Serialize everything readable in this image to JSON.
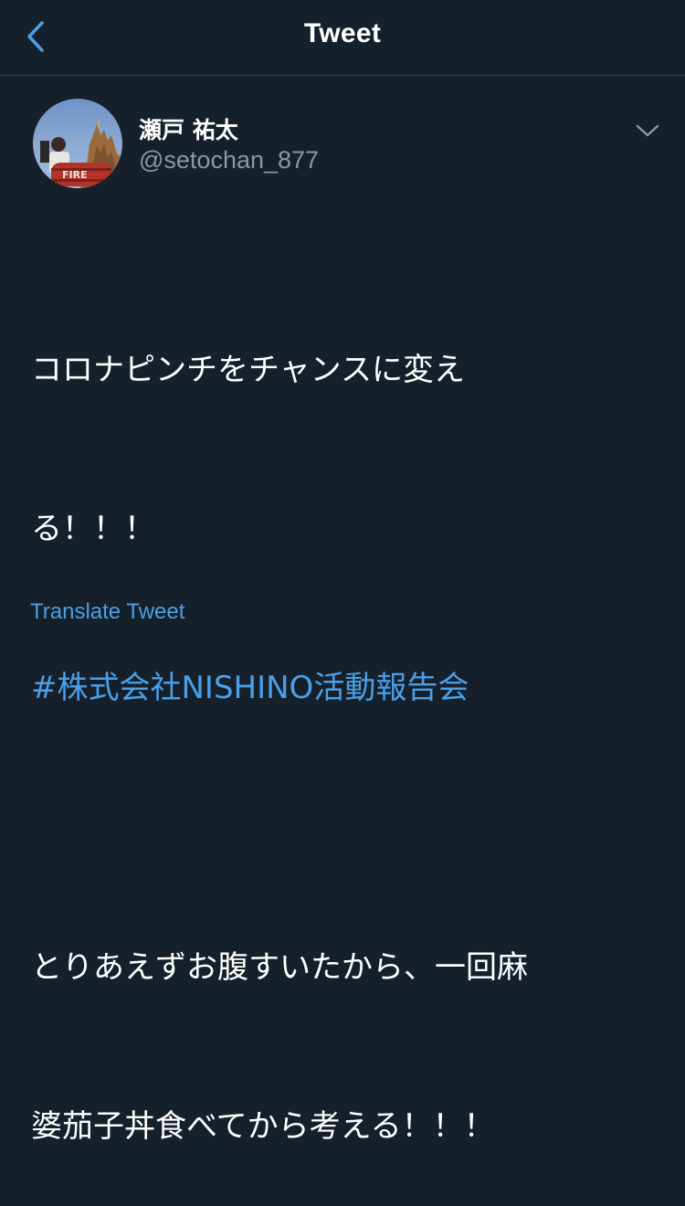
{
  "header": {
    "title": "Tweet",
    "back_icon": "chevron-left-icon"
  },
  "author": {
    "display_name": "瀬戸 祐太",
    "username": "@setochan_877",
    "avatar_text": "FIRE"
  },
  "tweet": {
    "line1": "コロナピンチをチャンスに変え",
    "line2": "る！！！",
    "hashtag": "#株式会社NISHINO活動報告会",
    "line3": "とりあえずお腹すいたから、一回麻",
    "line4": "婆茄子丼食べてから考える！！！"
  },
  "actions": {
    "translate_label": "Translate Tweet",
    "more_icon": "chevron-down-icon"
  },
  "colors": {
    "background": "#15202b",
    "accent": "#4a9fe8",
    "secondary_text": "#8899a6",
    "divider": "#38444d"
  }
}
